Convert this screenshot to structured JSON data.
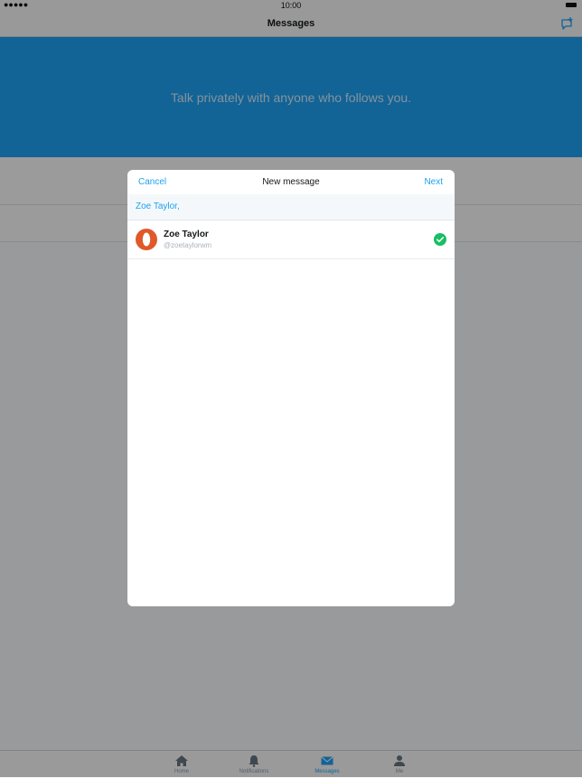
{
  "status_bar": {
    "signal": "●●●●●",
    "time": "10:00"
  },
  "nav": {
    "title": "Messages",
    "compose_icon": "compose-message-icon"
  },
  "banner": {
    "text": "Talk privately with anyone who follows you."
  },
  "tab_bar": {
    "tabs": [
      {
        "label": "Home",
        "icon": "home-icon"
      },
      {
        "label": "Notifications",
        "icon": "bell-icon"
      },
      {
        "label": "Messages",
        "icon": "envelope-icon",
        "active": true
      },
      {
        "label": "Me",
        "icon": "person-icon"
      }
    ]
  },
  "modal": {
    "cancel_label": "Cancel",
    "title": "New message",
    "next_label": "Next",
    "to_value": "Zoe Taylor,",
    "contacts": [
      {
        "name": "Zoe Taylor",
        "handle": "@zoetaylorwm",
        "selected": true
      }
    ]
  },
  "colors": {
    "accent": "#1da1f2",
    "avatar": "#e0592a",
    "check": "#17bf63"
  }
}
